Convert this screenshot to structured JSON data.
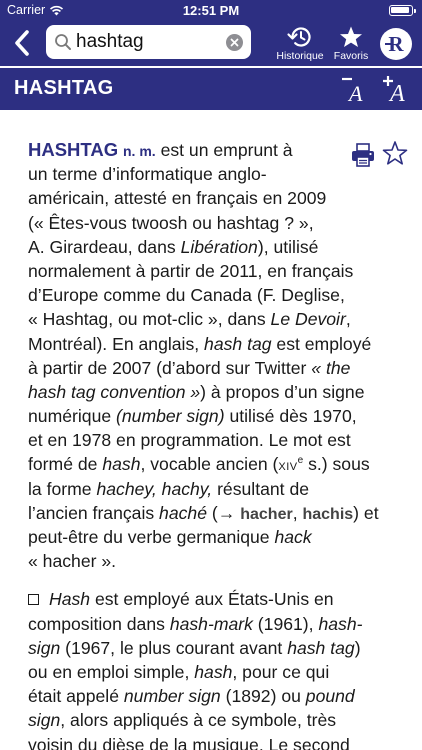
{
  "status": {
    "carrier": "Carrier",
    "time": "12:51 PM"
  },
  "search": {
    "value": "hashtag"
  },
  "nav": {
    "history_label": "Historique",
    "favorites_label": "Favoris",
    "logo_letter": "R"
  },
  "header": {
    "title": "HASHTAG"
  },
  "entry": {
    "headword": "HASHTAG",
    "grammar": "n. m.",
    "l1_a": "est un emprunt à",
    "l2": "un terme d’informatique anglo-",
    "l3": "américain, attesté en français en 2009",
    "l4": "(« Êtes-vous twoosh ou hashtag ? »,",
    "l5_a": "A. Girardeau, dans ",
    "l5_b": "Libération",
    "l5_c": "), utilisé",
    "l6": "normalement à partir de 2011, en français",
    "l7": "d’Europe comme du Canada (F. Deglise,",
    "l8_a": "« Hashtag, ou mot-clic », dans ",
    "l8_b": "Le Devoir",
    "l8_c": ",",
    "l9_a": "Montréal). En anglais, ",
    "l9_b": "hash tag",
    "l9_c": " est employé",
    "l10": "à partir de 2007 (d’abord sur Twitter ",
    "l10_b": "« the",
    "l11_a": "hash tag convention »",
    "l11_b": ") à propos d’un signe",
    "l12_a": "numérique ",
    "l12_b": "(number sign)",
    "l12_c": " utilisé dès 1970,",
    "l13": "et en 1978 en programmation. Le mot est",
    "l14_a": "formé de ",
    "l14_b": "hash",
    "l14_c": ", vocable ancien (",
    "l14_sc": "XIV",
    "l14_sup": "e",
    "l14_d": " s.) sous",
    "l15_a": "la forme ",
    "l15_b": "hachey, hachy,",
    "l15_c": " résultant de",
    "l16_a": "l’ancien français ",
    "l16_b": "haché",
    "l16_c": " (→ ",
    "l16_link1": "hacher",
    "l16_sep": ", ",
    "l16_link2": "hachis",
    "l16_d": ") et",
    "l17_a": "peut-être du verbe germanique ",
    "l17_b": "hack",
    "l18": "« hacher ».",
    "p2_l1_a": "Hash",
    "p2_l1_b": " est employé aux États-Unis en",
    "p2_l2_a": "composition dans ",
    "p2_l2_b": "hash-mark",
    "p2_l2_c": " (1961), ",
    "p2_l2_d": "hash-",
    "p2_l3_a": "sign",
    "p2_l3_b": " (1967, le plus courant avant ",
    "p2_l3_c": "hash tag",
    "p2_l3_d": ")",
    "p2_l4_a": "ou en emploi simple, ",
    "p2_l4_b": "hash",
    "p2_l4_c": ", pour ce qui",
    "p2_l5_a": "était appelé ",
    "p2_l5_b": "number sign",
    "p2_l5_c": " (1892) ou ",
    "p2_l5_d": "pound",
    "p2_l6_a": "sign",
    "p2_l6_b": ", alors appliqués à ce symbole, très",
    "p2_l7": "voisin du dièse de la musique. Le second"
  }
}
